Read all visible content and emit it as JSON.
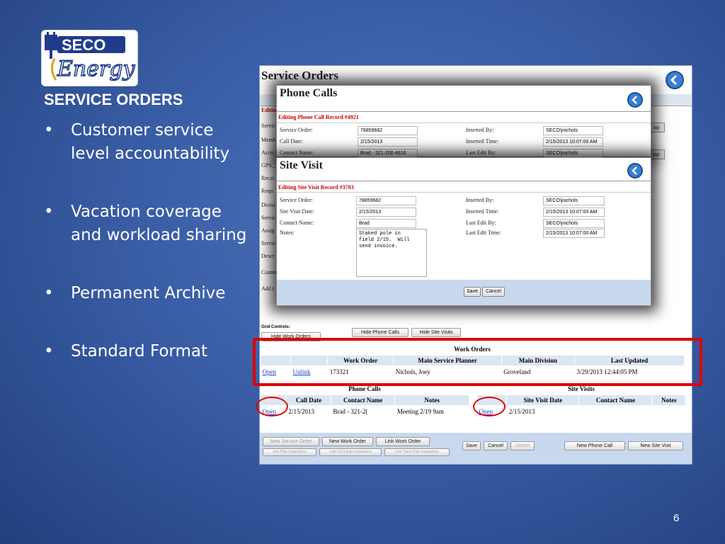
{
  "slide": {
    "title": "SERVICE ORDERS",
    "bullets": [
      {
        "marker": "•",
        "text": "Customer service level accountability"
      },
      {
        "marker": "•",
        "text": "Vacation coverage and workload sharing"
      },
      {
        "marker": "•",
        "text": "Permanent Archive"
      },
      {
        "marker": "•",
        "text": "Standard Format"
      }
    ],
    "page_number": "6",
    "logo": {
      "line1": "SECO",
      "line2": "Energy",
      "brand_color": "#1f3b8c"
    }
  },
  "service_orders": {
    "title": "Service Orders",
    "editing_tab": "Editin",
    "side_labels": [
      "Servic",
      "Memb",
      "Acco",
      "GPS_",
      "Recei",
      "Requ",
      "Divisi",
      "Servic",
      "Assig",
      "Servic",
      "Descr",
      "Comm",
      "Add t"
    ],
    "right_buttons": [
      "mp",
      "mp"
    ],
    "grid_controls_label": "Grid Controls:",
    "grid_buttons": {
      "hide_work_orders": "Hide Work Orders",
      "hide_phone_calls": "Hide Phone Calls",
      "hide_site_visits": "Hide Site Visits"
    },
    "work_orders": {
      "caption": "Work Orders",
      "headers": [
        "",
        "",
        "Work Order",
        "Main Service Planner",
        "Main Division",
        "Last Updated"
      ],
      "rows": [
        {
          "open": "Open",
          "unlink": "Unlink",
          "work_order": "173321",
          "planner": "Nichols, Joey",
          "division": "Groveland",
          "updated": "3/29/2013 12:44:05 PM"
        }
      ]
    },
    "phone_calls": {
      "caption": "Phone Calls",
      "headers": [
        "",
        "Call Date",
        "Contact Name",
        "Notes"
      ],
      "rows": [
        {
          "open": "Open",
          "date": "2/15/2013",
          "contact": "Brad - 321-2(",
          "notes": "Meeting 2/19 9am"
        }
      ]
    },
    "site_visits": {
      "caption": "Site Visits",
      "headers": [
        "",
        "Site Visit Date",
        "Contact Name",
        "Notes"
      ],
      "rows": [
        {
          "open": "Open",
          "date": "2/15/2013",
          "contact": "",
          "notes": ""
        }
      ]
    },
    "bottom_buttons": {
      "new_service_order": "New Service Order",
      "new_work_order": "New Work Order",
      "link_work_order": "Link Work Order",
      "link_pole": "Link Pole Inspections",
      "link_ug": "Link UG Equip Inspections",
      "link_trans": "Link Trans Pole Inspections",
      "save": "Save",
      "cancel": "Cancel",
      "delete": "Delete",
      "new_phone_call": "New Phone Call",
      "new_site_visit": "New Site Visit"
    }
  },
  "phone_call_dialog": {
    "title": "Phone Calls",
    "subtitle": "Editing Phone Call Record #4921",
    "fields": {
      "service_order_label": "Service Order:",
      "service_order": "78859682",
      "call_date_label": "Call Date:",
      "call_date": "2/15/2013",
      "contact_label": "Contact Name:",
      "contact": "Brad - 321-200-4816",
      "inserted_by_label": "Inserted By:",
      "inserted_by": "SECO\\jnichols",
      "inserted_time_label": "Inserted Time:",
      "inserted_time": "2/15/2013 10:07:00 AM",
      "last_edit_by_label": "Last Edit By:",
      "last_edit_by": "SECO\\jnichols"
    }
  },
  "site_visit_dialog": {
    "title": "Site Visit",
    "subtitle": "Editing Site Visit Record #3703",
    "fields": {
      "service_order_label": "Service Order:",
      "service_order": "78859682",
      "date_label": "Site Visit Date:",
      "date": "2/15/2013",
      "contact_label": "Contact Name:",
      "contact": "Brad",
      "notes_label": "Notes:",
      "notes": "Staked pole in\nfield 2/15.  Will\nsend invoice.",
      "inserted_by_label": "Inserted By:",
      "inserted_by": "SECO\\jnichols",
      "inserted_time_label": "Inserted Time:",
      "inserted_time": "2/15/2013 10:07:00 AM",
      "last_edit_by_label": "Last Edit By:",
      "last_edit_by": "SECO\\jnichols",
      "last_edit_time_label": "Last Edit Time:",
      "last_edit_time": "2/15/2013 10:07:00 AM"
    },
    "save": "Save",
    "cancel": "Cancel"
  },
  "colors": {
    "accent_red": "#e00000",
    "link_blue": "#1a3cc8",
    "header_blue": "#dce6f2"
  }
}
